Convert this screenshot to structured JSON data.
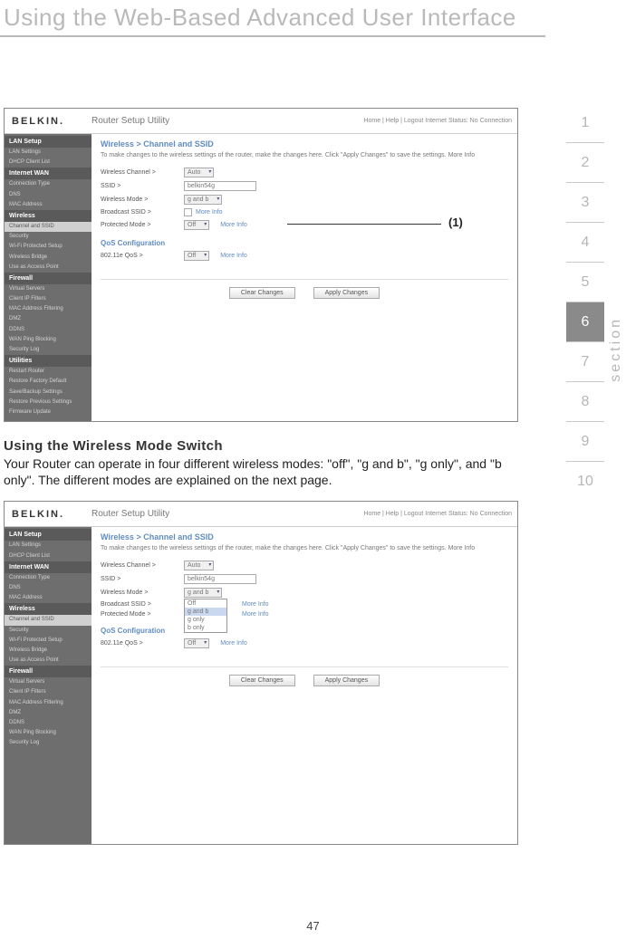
{
  "page": {
    "title": "Using the Web-Based Advanced User Interface",
    "number": "47"
  },
  "section_nav": {
    "label": "section",
    "items": [
      "1",
      "2",
      "3",
      "4",
      "5",
      "6",
      "7",
      "8",
      "9",
      "10"
    ],
    "active_index": 5
  },
  "callout": {
    "label": "(1)"
  },
  "subhead": "Using the Wireless Mode Switch",
  "body": "Your Router can operate in four different wireless modes: \"off\", \"g and b\", \"g only\", and \"b only\". The different modes are explained on the next page.",
  "screenshot1": {
    "logo": "BELKIN.",
    "utility": "Router Setup Utility",
    "toplinks": "Home | Help | Logout    Internet Status: No Connection",
    "breadcrumb": "Wireless > Channel and SSID",
    "desc": "To make changes to the wireless settings of the router, make the changes here. Click \"Apply Changes\" to save the settings. More Info",
    "rows": {
      "channel_label": "Wireless Channel >",
      "channel_value": "Auto",
      "ssid_label": "SSID >",
      "ssid_value": "belkin54g",
      "mode_label": "Wireless Mode >",
      "mode_value": "g and b",
      "broadcast_label": "Broadcast SSID >",
      "protected_label": "Protected Mode >",
      "protected_value": "Off",
      "moreinfo": "More Info"
    },
    "qos": {
      "title": "QoS Configuration",
      "row_label": "802.11e QoS >",
      "row_value": "Off",
      "moreinfo": "More Info"
    },
    "buttons": {
      "clear": "Clear Changes",
      "apply": "Apply Changes"
    },
    "sidebar": {
      "h1": "LAN Setup",
      "i1": "LAN Settings",
      "i2": "DHCP Client List",
      "h2": "Internet WAN",
      "i3": "Connection Type",
      "i4": "DNS",
      "i5": "MAC Address",
      "h3": "Wireless",
      "i6": "Channel and SSID",
      "i7": "Security",
      "i8": "Wi-Fi Protected Setup",
      "i9": "Wireless Bridge",
      "i10": "Use as Access Point",
      "h4": "Firewall",
      "i11": "Virtual Servers",
      "i12": "Client IP Filters",
      "i13": "MAC Address Filtering",
      "i14": "DMZ",
      "i15": "DDNS",
      "i16": "WAN Ping Blocking",
      "i17": "Security Log",
      "h5": "Utilities",
      "i18": "Restart Router",
      "i19": "Restore Factory Default",
      "i20": "Save/Backup Settings",
      "i21": "Restore Previous Settings",
      "i22": "Firmware Update"
    }
  },
  "screenshot2": {
    "logo": "BELKIN.",
    "utility": "Router Setup Utility",
    "toplinks": "Home | Help | Logout    Internet Status: No Connection",
    "breadcrumb": "Wireless > Channel and SSID",
    "desc": "To make changes to the wireless settings of the router, make the changes here. Click \"Apply Changes\" to save the settings. More Info",
    "rows": {
      "channel_label": "Wireless Channel >",
      "channel_value": "Auto",
      "ssid_label": "SSID >",
      "ssid_value": "belkin54g",
      "mode_label": "Wireless Mode >",
      "mode_sel": "g and b",
      "mode_options": [
        "Off",
        "g and b",
        "g only",
        "b only"
      ],
      "broadcast_label": "Broadcast SSID >",
      "protected_label": "Protected Mode >",
      "moreinfo": "More Info"
    },
    "qos": {
      "title": "QoS Configuration",
      "row_label": "802.11e QoS >",
      "row_value": "Off",
      "moreinfo": "More Info"
    },
    "buttons": {
      "clear": "Clear Changes",
      "apply": "Apply Changes"
    },
    "sidebar": {
      "h1": "LAN Setup",
      "i1": "LAN Settings",
      "i2": "DHCP Client List",
      "h2": "Internet WAN",
      "i3": "Connection Type",
      "i4": "DNS",
      "i5": "MAC Address",
      "h3": "Wireless",
      "i6": "Channel and SSID",
      "i7": "Security",
      "i8": "Wi-Fi Protected Setup",
      "i9": "Wireless Bridge",
      "i10": "Use as Access Point",
      "h4": "Firewall",
      "i11": "Virtual Servers",
      "i12": "Client IP Filters",
      "i13": "MAC Address Filtering",
      "i14": "DMZ",
      "i15": "DDNS",
      "i16": "WAN Ping Blocking",
      "i17": "Security Log"
    }
  }
}
